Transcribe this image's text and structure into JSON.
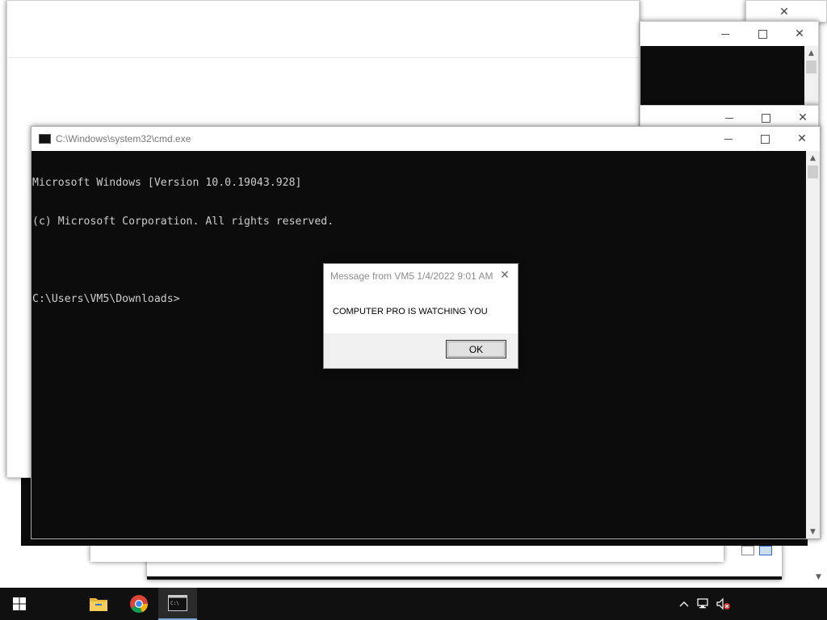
{
  "cmd_window": {
    "title": "C:\\Windows\\system32\\cmd.exe",
    "console_lines": [
      "Microsoft Windows [Version 10.0.19043.928]",
      "(c) Microsoft Corporation. All rights reserved.",
      "",
      "C:\\Users\\VM5\\Downloads>"
    ]
  },
  "message_dialog": {
    "title": "Message from VM5 1/4/2022 9:01 AM",
    "message": "COMPUTER PRO IS WATCHING YOU",
    "ok_label": "OK"
  },
  "taskbar": {
    "start_icon": "windows-logo-icon",
    "pinned": [
      {
        "name": "file-explorer-icon"
      },
      {
        "name": "chrome-icon"
      },
      {
        "name": "command-prompt-icon"
      }
    ],
    "tray": [
      "show-hidden-icons-chevron",
      "network-disconnected-icon",
      "volume-muted-icon"
    ]
  },
  "colors": {
    "console_bg": "#0c0c0c",
    "console_text": "#cccccc",
    "taskbar_bg": "#101010",
    "dialog_footer": "#f0f0f0"
  }
}
